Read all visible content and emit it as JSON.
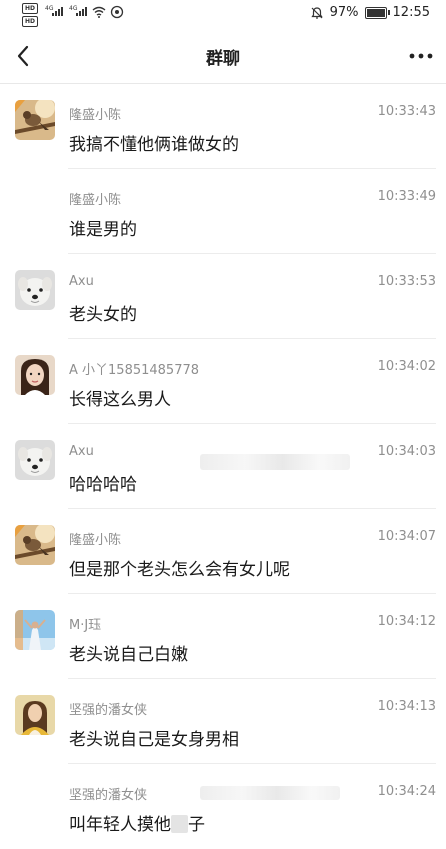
{
  "status_bar": {
    "network_left_1": "4G",
    "network_left_2": "4G",
    "battery": "97%",
    "time": "12:55"
  },
  "nav": {
    "title": "群聊",
    "back_icon": "chevron-left-icon",
    "more_icon": "more-dots-icon"
  },
  "messages": [
    {
      "sender": "隆盛小陈",
      "time": "10:33:43",
      "text": "我搞不懂他俩谁做女的",
      "avatar": "bird-avatar"
    },
    {
      "sender": "隆盛小陈",
      "time": "10:33:49",
      "text": "谁是男的",
      "avatar": ""
    },
    {
      "sender": "Axu",
      "time": "10:33:53",
      "text": "老头女的",
      "avatar": "dog-avatar"
    },
    {
      "sender": "A 小丫15851485778",
      "time": "10:34:02",
      "text": "长得这么男人",
      "avatar": "girl-avatar"
    },
    {
      "sender": "Axu",
      "time": "10:34:03",
      "text": "哈哈哈哈",
      "avatar": "dog-avatar"
    },
    {
      "sender": "隆盛小陈",
      "time": "10:34:07",
      "text": "但是那个老头怎么会有女儿呢",
      "avatar": "bird-avatar"
    },
    {
      "sender": "M·J珏",
      "time": "10:34:12",
      "text": "老头说自己白嫩",
      "avatar": "sky-avatar"
    },
    {
      "sender": "坚强的潘女侠",
      "time": "10:34:13",
      "text": "老头说自己是女身男相",
      "avatar": "lady-avatar"
    },
    {
      "sender": "坚强的潘女侠",
      "time": "10:34:24",
      "text": "叫年轻人摸他",
      "text_tail": "子",
      "avatar": ""
    }
  ]
}
